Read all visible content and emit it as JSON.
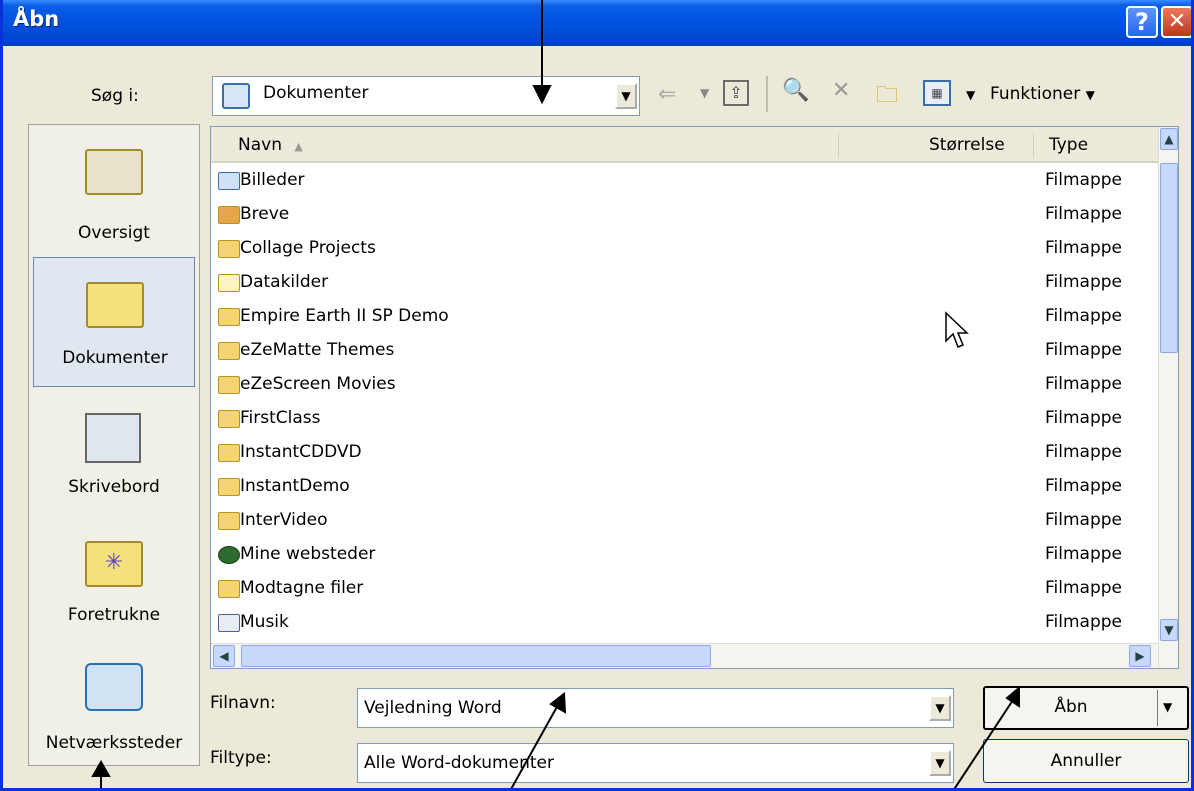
{
  "window": {
    "title": "Åbn"
  },
  "title_buttons": {
    "help": "?",
    "close": "✕"
  },
  "lookin": {
    "label": "Søg i:",
    "value": "Dokumenter"
  },
  "toolbar": {
    "tools_label": "Funktioner"
  },
  "places": [
    {
      "label": "Oversigt",
      "icon": "overview-icon"
    },
    {
      "label": "Dokumenter",
      "icon": "documents-folder-icon"
    },
    {
      "label": "Skrivebord",
      "icon": "desktop-icon"
    },
    {
      "label": "Foretrukne",
      "icon": "favorites-folder-icon"
    },
    {
      "label": "Netværkssteder",
      "icon": "network-places-icon"
    }
  ],
  "columns": {
    "name": "Navn",
    "size": "Størrelse",
    "type": "Type"
  },
  "files": [
    {
      "name": "Billeder",
      "type": "Filmappe"
    },
    {
      "name": "Breve",
      "type": "Filmappe"
    },
    {
      "name": "Collage Projects",
      "type": "Filmappe"
    },
    {
      "name": "Datakilder",
      "type": "Filmappe"
    },
    {
      "name": "Empire Earth II SP Demo",
      "type": "Filmappe"
    },
    {
      "name": "eZeMatte Themes",
      "type": "Filmappe"
    },
    {
      "name": "eZeScreen Movies",
      "type": "Filmappe"
    },
    {
      "name": "FirstClass",
      "type": "Filmappe"
    },
    {
      "name": "InstantCDDVD",
      "type": "Filmappe"
    },
    {
      "name": "InstantDemo",
      "type": "Filmappe"
    },
    {
      "name": "InterVideo",
      "type": "Filmappe"
    },
    {
      "name": "Mine websteder",
      "type": "Filmappe"
    },
    {
      "name": "Modtagne filer",
      "type": "Filmappe"
    },
    {
      "name": "Musik",
      "type": "Filmappe"
    }
  ],
  "filename": {
    "label": "Filnavn:",
    "value": "Vejledning Word"
  },
  "filetype": {
    "label": "Filtype:",
    "value": "Alle Word-dokumenter"
  },
  "buttons": {
    "open": "Åbn",
    "cancel": "Annuller"
  },
  "colors": {
    "titlebar": "#0052e0",
    "dialog_bg": "#ece9d8",
    "selection": "#e0e7f0"
  }
}
